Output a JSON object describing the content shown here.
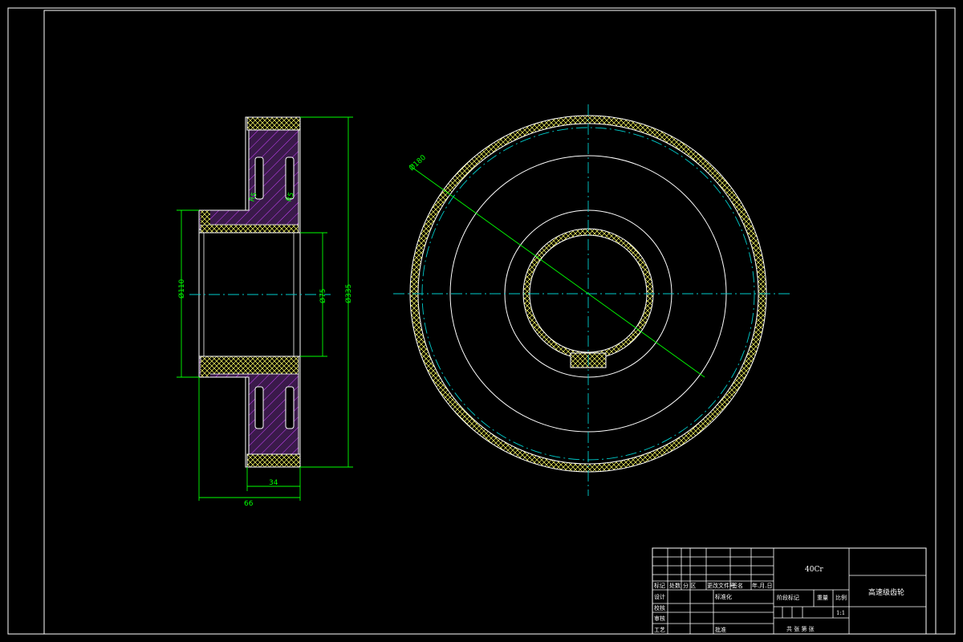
{
  "drawing": {
    "dimensions": {
      "d_hub": "Ø110",
      "d_bore": "Ø75",
      "d_outer": "Ø335",
      "d_pitch": "Ø180",
      "width_rim": "34",
      "width_total": "66",
      "fillet_left": "R5",
      "fillet_right": "R5"
    },
    "colors": {
      "background": "#000000",
      "lines": "#ffffff",
      "dimension": "#00ff00",
      "centerline": "#00cccc",
      "hatch_cross": "#ffff66",
      "hatch_section": "#cc44ff",
      "section_fill": "#3a1a4a"
    }
  },
  "title_block": {
    "material": "40Cr",
    "part_name": "高速级齿轮",
    "scale": "1:1",
    "header_labels": [
      "标记",
      "处数",
      "分 区",
      "更改文件号",
      "签名",
      "年.月.日"
    ],
    "row_labels": [
      "设计",
      "校核",
      "审核",
      "工艺"
    ],
    "std_label": "标准化",
    "approve_label": "批准",
    "stage_label": "阶段标记",
    "weight_label": "重量",
    "scale_label": "比例",
    "sheet_label": "共  张  第  张"
  }
}
